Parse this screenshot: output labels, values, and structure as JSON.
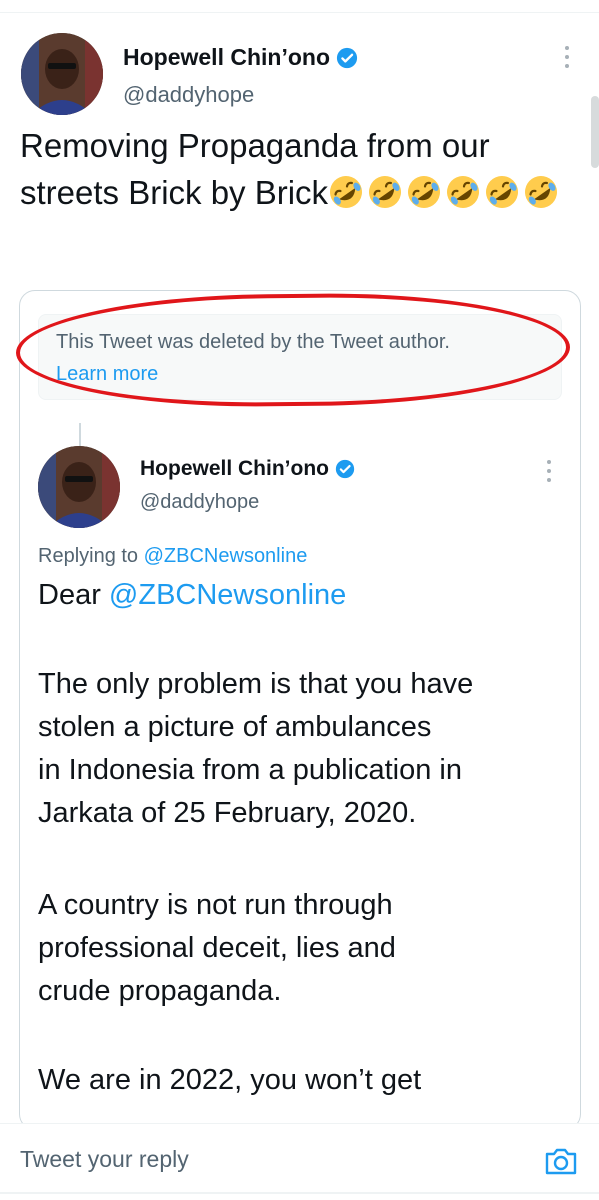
{
  "tweet": {
    "author_name": "Hopewell Chin’ono",
    "author_handle": "@daddyhope",
    "text": "Removing Propaganda from our streets Brick by Brick",
    "emoji_count": 6,
    "emoji_name": "rolling-on-floor-laughing"
  },
  "deleted_notice": {
    "text": "This Tweet was deleted by the Tweet author.",
    "link": "Learn more"
  },
  "quoted_tweet": {
    "author_name": "Hopewell Chin’ono",
    "author_handle": "@daddyhope",
    "replying_prefix": "Replying to ",
    "replying_to": "@ZBCNewsonline",
    "greeting_prefix": "Dear ",
    "greeting_mention": "@ZBCNewsonline",
    "paragraph_1": [
      "The only problem is that you have",
      "stolen a picture of ambulances",
      "in Indonesia from a publication in",
      "Jarkata of 25 February, 2020."
    ],
    "paragraph_2": [
      "A country is not run through",
      "professional deceit, lies and",
      "crude propaganda."
    ],
    "paragraph_3": [
      "We are in 2022, you won’t get"
    ]
  },
  "reply_bar": {
    "placeholder": "Tweet your reply"
  },
  "colors": {
    "accent": "#1d9bf0",
    "annotation_ring": "#e0161a",
    "secondary_text": "#536471"
  }
}
